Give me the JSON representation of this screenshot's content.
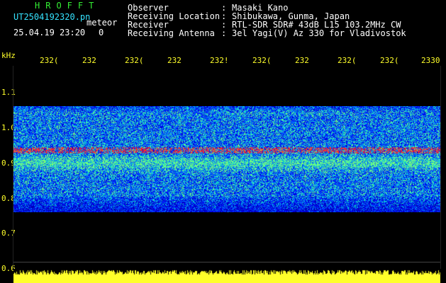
{
  "header": {
    "app_title": "HROFFT",
    "file_name": "UT2504192320.pn",
    "file_tag": "meteor",
    "date_time": "25.04.19 23:20",
    "count": "0"
  },
  "info": [
    {
      "label": "Observer",
      "sep": ":",
      "value": "Masaki Kano"
    },
    {
      "label": "Receiving Location",
      "sep": ":",
      "value": "Shibukawa, Gunma, Japan"
    },
    {
      "label": "Receiver",
      "sep": ":",
      "value": "RTL-SDR SDR# 43dB L15 103.2MHz CW"
    },
    {
      "label": "Receiving Antenna",
      "sep": ":",
      "value": "3el Yagi(V) Az 330 for Vladivostok"
    }
  ],
  "axis": {
    "unit": "kHz",
    "time_ticks": [
      "232(",
      "232",
      "232(",
      "232",
      "232!",
      "232(",
      "232",
      "232(",
      "232(",
      "2330"
    ],
    "freq_ticks": [
      "1.1",
      "1.0",
      "0.9",
      "0.8",
      "0.7",
      "0.6"
    ]
  },
  "colors": {
    "background": "#000000",
    "title_green": "#33ee33",
    "header_cyan": "#35e3ff",
    "axis_yellow": "#ffff2a",
    "noise_blue": "#1a3cff",
    "signal_red": "#ff2a2a"
  }
}
